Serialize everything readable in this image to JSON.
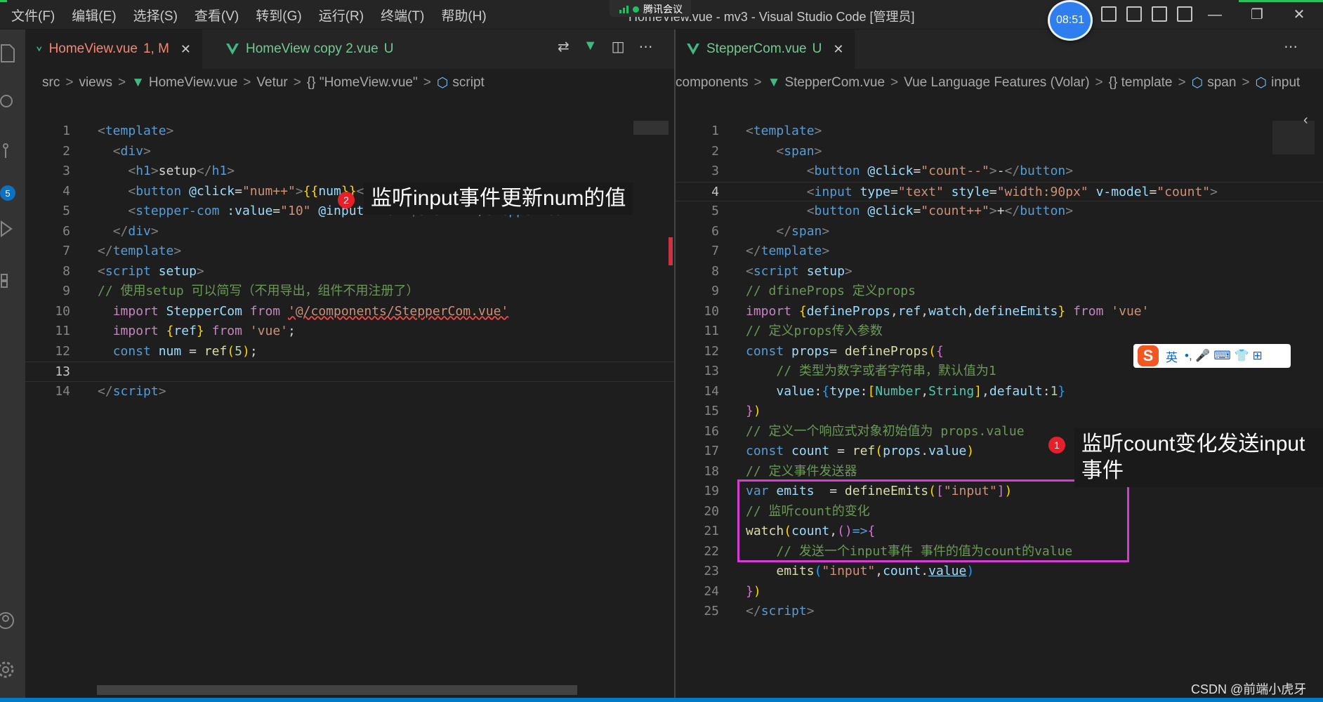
{
  "window": {
    "title": "HomeView.vue - mv3 - Visual Studio Code [管理员]",
    "menu": [
      "文件(F)",
      "编辑(E)",
      "选择(S)",
      "查看(V)",
      "转到(G)",
      "运行(R)",
      "终端(T)",
      "帮助(H)"
    ],
    "meeting_label": "腾讯会议",
    "clock": "08:51",
    "controls": [
      "—",
      "❐",
      "✕"
    ]
  },
  "activity": {
    "badge": "5"
  },
  "left": {
    "tabs": [
      {
        "label": "HomeView.vue",
        "status": "1, M",
        "close": "✕",
        "color": "#f48771"
      },
      {
        "label": "HomeView copy 2.vue",
        "status": "U",
        "close": "",
        "color": "#73c991"
      }
    ],
    "breadcrumb": [
      "src",
      "views",
      "HomeView.vue",
      "Vetur",
      "{} \"HomeView.vue\"",
      "script"
    ],
    "line_numbers": [
      "1",
      "2",
      "3",
      "4",
      "5",
      "6",
      "7",
      "8",
      "9",
      "10",
      "11",
      "12",
      "13",
      "14"
    ],
    "current_line": "13"
  },
  "right": {
    "tabs": [
      {
        "label": "StepperCom.vue",
        "status": "U",
        "close": "✕",
        "color": "#73c991"
      }
    ],
    "breadcrumb": [
      "components",
      "StepperCom.vue",
      "Vue Language Features (Volar)",
      "{} template",
      "span",
      "input"
    ],
    "line_numbers": [
      "1",
      "2",
      "3",
      "4",
      "5",
      "6",
      "7",
      "8",
      "9",
      "10",
      "11",
      "12",
      "13",
      "14",
      "15",
      "16",
      "17",
      "18",
      "19",
      "20",
      "21",
      "22",
      "23",
      "24",
      "25"
    ],
    "current_line": "4"
  },
  "annotations": [
    {
      "num": "2",
      "text": "监听input事件更新num的值"
    },
    {
      "num": "1",
      "text_line1": "监听count变化发送input",
      "text_line2": "事件"
    }
  ],
  "ime": {
    "logo": "S",
    "lang": "英",
    "items": "•, 🎤 ⌨ 👕 ⊞"
  },
  "watermark": "CSDN @前端小虎牙",
  "colors": {
    "accent": "#007acc",
    "annotation_box": "#d63bd6",
    "annotation_badge": "#e5202a"
  }
}
